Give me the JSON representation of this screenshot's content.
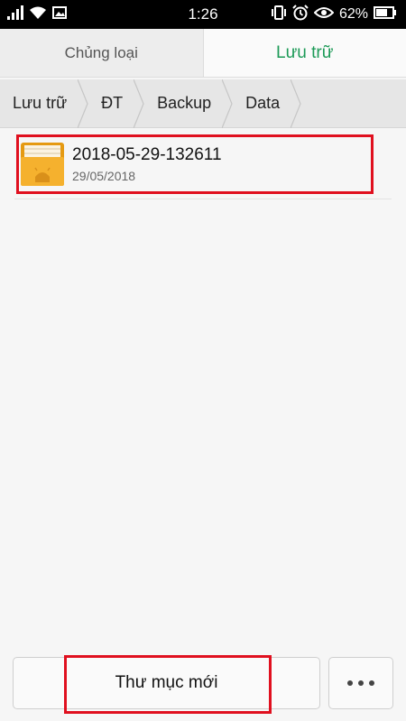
{
  "status_bar": {
    "time": "1:26",
    "battery_percent": "62%",
    "icons": [
      "signal-icon",
      "wifi-icon",
      "image-notification-icon",
      "vibrate-icon",
      "alarm-icon",
      "eye-icon",
      "battery-icon"
    ]
  },
  "tabs": [
    {
      "label": "Chủng loại",
      "active": false
    },
    {
      "label": "Lưu trữ",
      "active": true
    }
  ],
  "breadcrumb": [
    "Lưu trữ",
    "ĐT",
    "Backup",
    "Data"
  ],
  "files": [
    {
      "name": "2018-05-29-132611",
      "date": "29/05/2018",
      "icon": "android-folder-icon"
    }
  ],
  "bottom": {
    "new_folder_label": "Thư mục mới",
    "more_icon": "more-dots-icon"
  },
  "colors": {
    "accent_green": "#1c9a57",
    "highlight_red": "#e0101f",
    "folder_orange": "#f2a81d"
  }
}
